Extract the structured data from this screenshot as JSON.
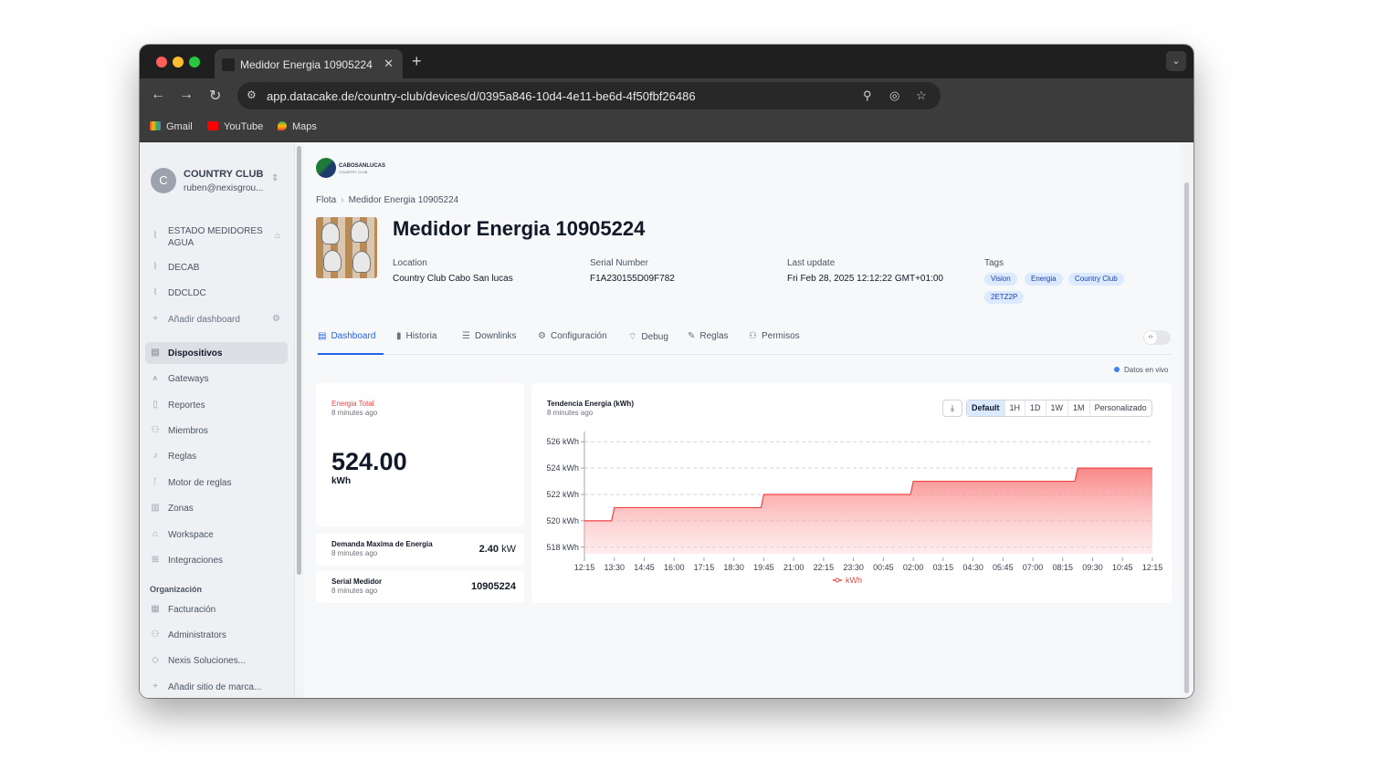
{
  "browser": {
    "tab_title": "Medidor Energia 10905224",
    "url": "app.datacake.de/country-club/devices/d/0395a846-10d4-4e11-be6d-4f50fbf26486",
    "bookmarks": [
      "Gmail",
      "YouTube",
      "Maps"
    ]
  },
  "sidebar": {
    "org_initial": "C",
    "org_name": "COUNTRY CLUB",
    "org_email": "ruben@nexisgrou...",
    "dashboards": [
      "ESTADO MEDIDORES",
      "AGUA",
      "DECAB",
      "DDCLDC"
    ],
    "add_dashboard": "Añadir dashboard",
    "nav": [
      "Dispositivos",
      "Gateways",
      "Reportes",
      "Miembros",
      "Reglas",
      "Motor de reglas",
      "Zonas",
      "Workspace",
      "Integraciones"
    ],
    "org_section": "Organización",
    "org_nav": [
      "Facturación",
      "Administrators",
      "Nexis Soluciones...",
      "Añadir sitio de marca..."
    ]
  },
  "header": {
    "logo_text": "CABOSANLUCAS",
    "logo_sub": "COUNTRY CLUB",
    "breadcrumb": [
      "Flota",
      "Medidor Energia 10905224"
    ],
    "title": "Medidor Energia 10905224",
    "meta": [
      {
        "label": "Location",
        "value": "Country Club Cabo San lucas"
      },
      {
        "label": "Serial Number",
        "value": "F1A230155D09F782"
      },
      {
        "label": "Last update",
        "value": "Fri Feb 28, 2025 12:12:22 GMT+01:00"
      }
    ],
    "tags_label": "Tags",
    "tags": [
      "Vision",
      "Energia",
      "Country Club",
      "2ETZ2P"
    ]
  },
  "tabs": [
    "Dashboard",
    "Historia",
    "Downlinks",
    "Configuración",
    "Debug",
    "Reglas",
    "Permisos"
  ],
  "live_label": "Datos en vivo",
  "widgets": {
    "energia_total": {
      "title": "Energia Total",
      "ago": "8 minutes ago",
      "value": "524.00",
      "unit": "kWh"
    },
    "demanda": {
      "title": "Demanda Maxima de Energia",
      "ago": "8 minutes ago",
      "value": "2.40",
      "unit": "kW"
    },
    "serial": {
      "title": "Serial Medidor",
      "ago": "8 minutes ago",
      "value": "10905224"
    }
  },
  "chart_widget": {
    "title": "Tendencia Energia (kWh)",
    "ago": "8 minutes ago",
    "ranges": [
      "Default",
      "1H",
      "1D",
      "1W",
      "1M",
      "Personalizado"
    ],
    "selected_range": "Default"
  },
  "chart_data": {
    "type": "area",
    "x": [
      "12:15",
      "13:30",
      "14:45",
      "16:00",
      "17:15",
      "18:30",
      "19:45",
      "21:00",
      "22:15",
      "23:30",
      "00:45",
      "02:00",
      "03:15",
      "04:30",
      "05:45",
      "07:00",
      "08:15",
      "09:30",
      "10:45",
      "12:15"
    ],
    "series": [
      {
        "name": "kWh",
        "color": "#ef4444",
        "steps": [
          [
            0,
            520
          ],
          [
            1,
            521
          ],
          [
            6,
            522
          ],
          [
            11,
            523
          ],
          [
            16.5,
            524
          ],
          [
            19,
            524
          ]
        ]
      }
    ],
    "y_ticks": [
      "526 kWh",
      "524 kWh",
      "522 kWh",
      "520 kWh",
      "518 kWh"
    ],
    "ylim": [
      517.5,
      526.5
    ],
    "grid": true,
    "legend": "bottom"
  }
}
